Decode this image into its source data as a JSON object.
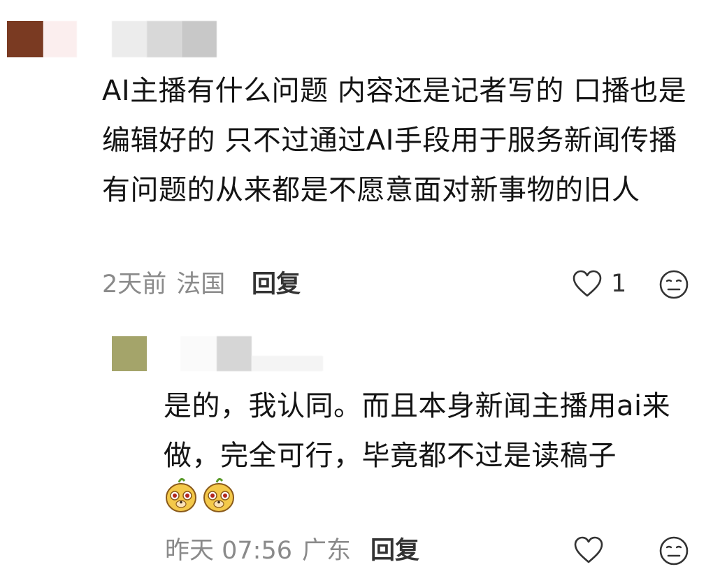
{
  "comment": {
    "avatar_color": "#7a3a22",
    "text": "AI主播有什么问题 内容还是记者写的 口播也是编辑好的 只不过通过AI手段用于服务新闻传播 有问题的从来都是不愿意面对新事物的旧人",
    "time": "2天前",
    "location": "法国",
    "reply_label": "回复",
    "like_count": "1",
    "like_icon": "heart-outline-icon",
    "dislike_icon": "meh-face-icon"
  },
  "reply": {
    "avatar_color": "#a4a46a",
    "text": "是的，我认同。而且本身新闻主播用ai来做，完全可行，毕竟都不过是读稿子",
    "emoji_count": 2,
    "time": "昨天 07:56",
    "location": "广东",
    "reply_label": "回复",
    "like_icon": "heart-outline-icon",
    "dislike_icon": "meh-face-icon"
  }
}
